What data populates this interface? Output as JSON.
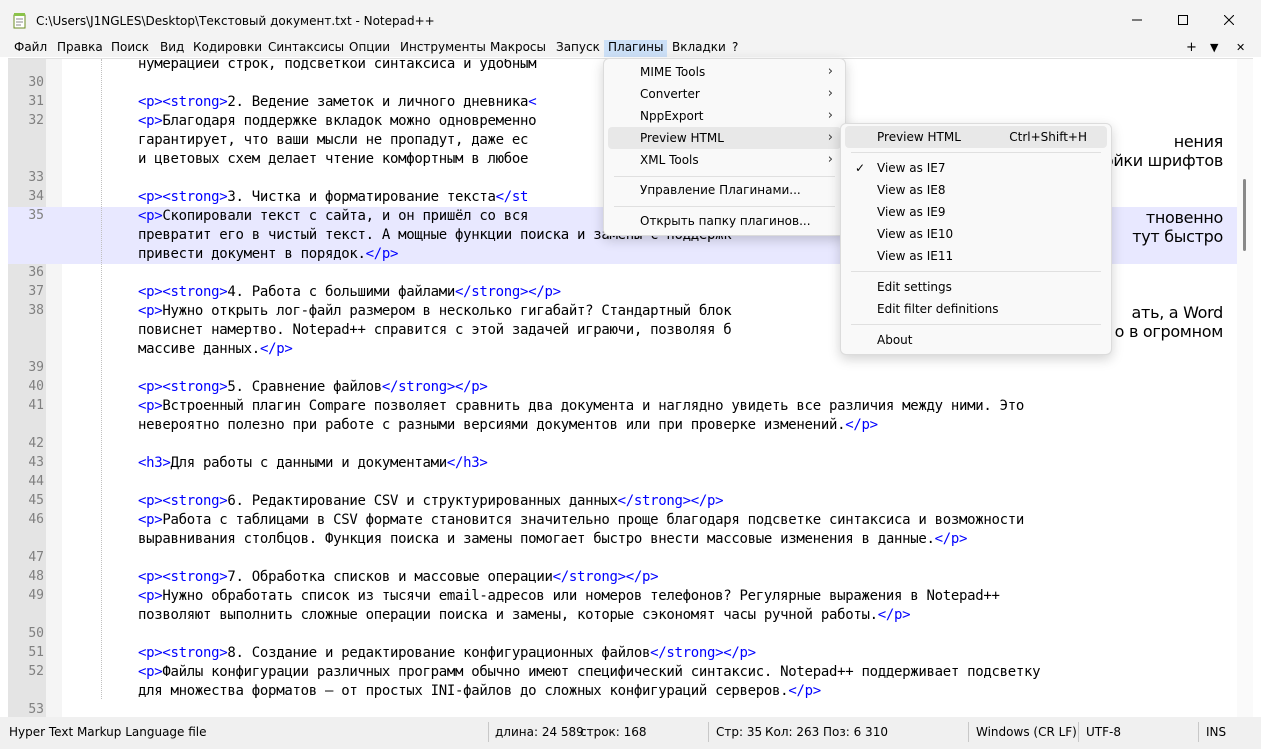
{
  "window": {
    "title": "C:\\Users\\J1NGLES\\Desktop\\Текстовый документ.txt - Notepad++"
  },
  "menubar": {
    "items": [
      "Файл",
      "Правка",
      "Поиск",
      "Вид",
      "Кодировки",
      "Синтаксисы",
      "Опции",
      "Инструменты",
      "Макросы",
      "Запуск",
      "Плагины",
      "Вкладки",
      "?"
    ],
    "right": {
      "add": "+",
      "dropdown": "▼",
      "close": "✕"
    }
  },
  "editor": {
    "lines": [
      {
        "n": "",
        "t": "нумерацией строк, подсветкой синтаксиса и удобным"
      },
      {
        "n": "30",
        "t": ""
      },
      {
        "n": "31",
        "t": "<p><strong>2. Ведение заметок и личного дневника<"
      },
      {
        "n": "32",
        "t": "<p>Благодаря поддержке вкладок можно одновременно"
      },
      {
        "n": "",
        "t": "гарантирует, что ваши мысли не пропадут, даже ес"
      },
      {
        "n": "",
        "t": "и цветовых схем делает чтение комфортным в любое"
      },
      {
        "n": "33",
        "t": ""
      },
      {
        "n": "34",
        "t": "<p><strong>3. Чистка и форматирование текста</st"
      },
      {
        "n": "35",
        "t": "<p>Скопировали текст с сайта, и он пришёл со вся"
      },
      {
        "n": "",
        "t": "превратит его в чистый текст. А мощные функции поиска и замены с поддержк"
      },
      {
        "n": "",
        "t": "привести документ в порядок.</p>"
      },
      {
        "n": "36",
        "t": ""
      },
      {
        "n": "37",
        "t": "<p><strong>4. Работа с большими файлами</strong></p>"
      },
      {
        "n": "38",
        "t": "<p>Нужно открыть лог-файл размером в несколько гигабайт? Стандартный блок"
      },
      {
        "n": "",
        "t": "повиснет намертво. Notepad++ справится с этой задачей играючи, позволяя б"
      },
      {
        "n": "",
        "t": "массиве данных.</p>"
      },
      {
        "n": "39",
        "t": ""
      },
      {
        "n": "40",
        "t": "<p><strong>5. Сравнение файлов</strong></p>"
      },
      {
        "n": "41",
        "t": "<p>Встроенный плагин Compare позволяет сравнить два документа и наглядно увидеть все различия между ними. Это"
      },
      {
        "n": "",
        "t": "невероятно полезно при работе с разными версиями документов или при проверке изменений.</p>"
      },
      {
        "n": "42",
        "t": ""
      },
      {
        "n": "43",
        "t": "<h3>Для работы с данными и документами</h3>"
      },
      {
        "n": "44",
        "t": ""
      },
      {
        "n": "45",
        "t": "<p><strong>6. Редактирование CSV и структурированных данных</strong></p>"
      },
      {
        "n": "46",
        "t": "<p>Работа с таблицами в CSV формате становится значительно проще благодаря подсветке синтаксиса и возможности"
      },
      {
        "n": "",
        "t": "выравнивания столбцов. Функция поиска и замены помогает быстро внести массовые изменения в данные.</p>"
      },
      {
        "n": "47",
        "t": ""
      },
      {
        "n": "48",
        "t": "<p><strong>7. Обработка списков и массовые операции</strong></p>"
      },
      {
        "n": "49",
        "t": "<p>Нужно обработать список из тысячи email-адресов или номеров телефонов? Регулярные выражения в Notepad++"
      },
      {
        "n": "",
        "t": "позволяют выполнить сложные операции поиска и замены, которые сэкономят часы ручной работы.</p>"
      },
      {
        "n": "50",
        "t": ""
      },
      {
        "n": "51",
        "t": "<p><strong>8. Создание и редактирование конфигурационных файлов</strong></p>"
      },
      {
        "n": "52",
        "t": "<p>Файлы конфигурации различных программ обычно имеют специфический синтаксис. Notepad++ поддерживает подсветку"
      },
      {
        "n": "",
        "t": "для множества форматов — от простых INI-файлов до сложных конфигураций серверов.</p>"
      },
      {
        "n": "53",
        "t": ""
      }
    ],
    "right_fragments": [
      {
        "row": 4,
        "t": "нения"
      },
      {
        "row": 5,
        "t": "ойки шрифтов"
      },
      {
        "row": 8,
        "t": "тновенно"
      },
      {
        "row": 9,
        "t": "тут быстро"
      },
      {
        "row": 13,
        "t": "ать, а Word"
      },
      {
        "row": 14,
        "t": "о в огромном"
      }
    ]
  },
  "plugins_menu": {
    "items": [
      {
        "label": "MIME Tools",
        "arrow": "›"
      },
      {
        "label": "Converter",
        "arrow": "›"
      },
      {
        "label": "NppExport",
        "arrow": "›"
      },
      {
        "label": "Preview HTML",
        "arrow": "›"
      },
      {
        "label": "XML Tools",
        "arrow": "›"
      },
      {
        "label": "Управление Плагинами..."
      },
      {
        "label": "Открыть папку плагинов..."
      }
    ]
  },
  "preview_submenu": {
    "items": [
      {
        "label": "Preview HTML",
        "shortcut": "Ctrl+Shift+H"
      },
      {
        "label": "View as IE7",
        "check": "✓"
      },
      {
        "label": "View as IE8"
      },
      {
        "label": "View as IE9"
      },
      {
        "label": "View as IE10"
      },
      {
        "label": "View as IE11"
      },
      {
        "label": "Edit settings"
      },
      {
        "label": "Edit filter definitions"
      },
      {
        "label": "About"
      }
    ]
  },
  "statusbar": {
    "language": "Hyper Text Markup Language file",
    "length": "длина: 24 589",
    "lines": "строк: 168",
    "ln": "Стр: 35",
    "col": "Кол: 263",
    "pos": "Поз: 6 310",
    "eol": "Windows (CR LF)",
    "encoding": "UTF-8",
    "mode": "INS"
  }
}
